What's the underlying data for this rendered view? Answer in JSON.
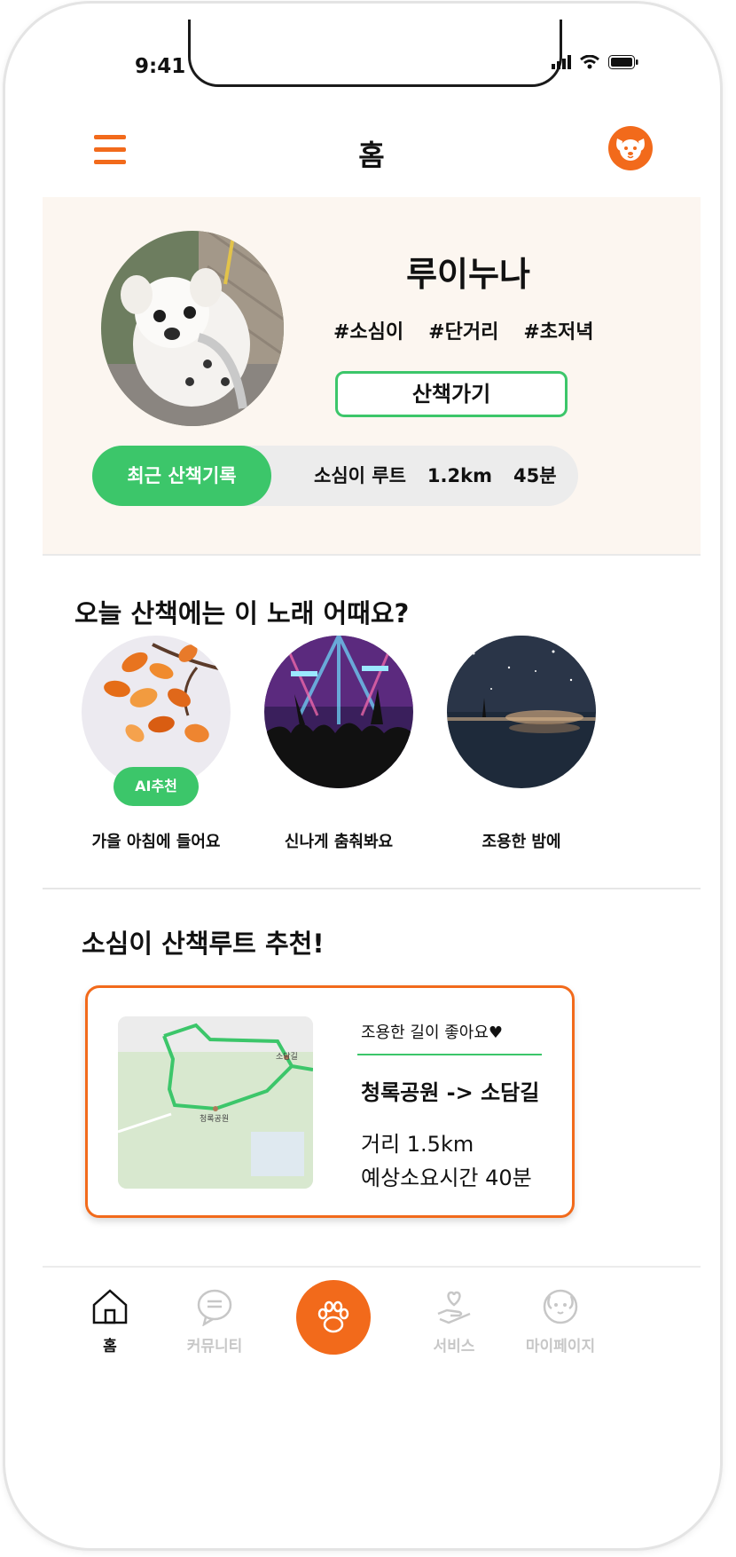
{
  "status_bar": {
    "time": "9:41"
  },
  "header": {
    "title": "홈"
  },
  "profile": {
    "name": "루이누나",
    "tags": [
      "#소심이",
      "#단거리",
      "#초저녁"
    ],
    "walk_button": "산책가기",
    "recent": {
      "label": "최근 산책기록",
      "route": "소심이 루트",
      "distance": "1.2km",
      "duration": "45분"
    }
  },
  "music": {
    "title": "오늘 산책에는 이 노래 어때요?",
    "items": [
      {
        "label": "가을 아침에 들어요",
        "badge": "AI추천"
      },
      {
        "label": "신나게 춤춰봐요"
      },
      {
        "label": "조용한 밤에"
      }
    ]
  },
  "route": {
    "title": "소심이 산책루트 추천!",
    "note": "조용한 길이 좋아요♥",
    "path": "청록공원 -> 소담길",
    "distance": "거리 1.5km",
    "time": "예상소요시간 40분",
    "map_labels": {
      "park": "청록공원",
      "street": "소담길"
    }
  },
  "nav": {
    "items": [
      {
        "label": "홈",
        "icon": "home-icon",
        "active": true
      },
      {
        "label": "커뮤니티",
        "icon": "chat-icon"
      },
      {
        "label": "",
        "icon": "paw-icon"
      },
      {
        "label": "서비스",
        "icon": "heart-hand-icon"
      },
      {
        "label": "마이페이지",
        "icon": "dog-face-icon"
      }
    ]
  },
  "colors": {
    "accent": "#f26a1b",
    "green": "#3cc66a",
    "profile_bg": "#fcf6f0"
  }
}
